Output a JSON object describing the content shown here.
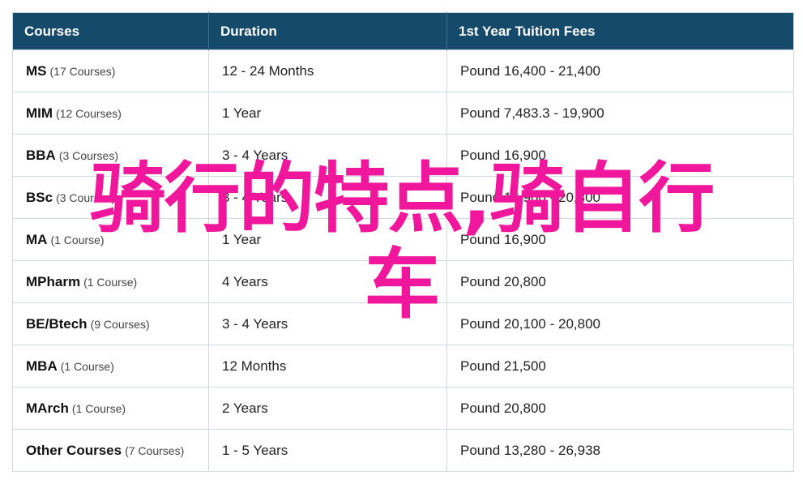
{
  "table": {
    "headers": {
      "courses": "Courses",
      "duration": "Duration",
      "fees": "1st Year Tuition Fees"
    },
    "rows": [
      {
        "name": "MS",
        "count": "(17 Courses)",
        "duration": "12 - 24 Months",
        "fee": "Pound 16,400 - 21,400"
      },
      {
        "name": "MIM",
        "count": "(12 Courses)",
        "duration": "1 Year",
        "fee": "Pound 7,483.3 - 19,900"
      },
      {
        "name": "BBA",
        "count": "(3 Courses)",
        "duration": "3 - 4 Years",
        "fee": "Pound 16,900"
      },
      {
        "name": "BSc",
        "count": "(3 Courses)",
        "duration": "3 - 4 Years",
        "fee": "Pound 16,900 - 20,800"
      },
      {
        "name": "MA",
        "count": "(1 Course)",
        "duration": "1 Year",
        "fee": "Pound 16,900"
      },
      {
        "name": "MPharm",
        "count": "(1 Course)",
        "duration": "4 Years",
        "fee": "Pound 20,800"
      },
      {
        "name": "BE/Btech",
        "count": "(9 Courses)",
        "duration": "3 - 4 Years",
        "fee": "Pound 20,100 - 20,800"
      },
      {
        "name": "MBA",
        "count": "(1 Course)",
        "duration": "12 Months",
        "fee": "Pound 21,500"
      },
      {
        "name": "MArch",
        "count": "(1 Course)",
        "duration": "2 Years",
        "fee": "Pound 20,800"
      },
      {
        "name": "Other Courses",
        "count": "(7 Courses)",
        "duration": "1 - 5 Years",
        "fee": "Pound 13,280 - 26,938"
      }
    ]
  },
  "overlay": {
    "line1": "骑行的特点,骑自行",
    "line2": "车"
  },
  "colors": {
    "header_bg": "#164a6a",
    "header_text": "#ffffff",
    "overlay_text": "#f0179d",
    "border": "#cfd8e3"
  }
}
